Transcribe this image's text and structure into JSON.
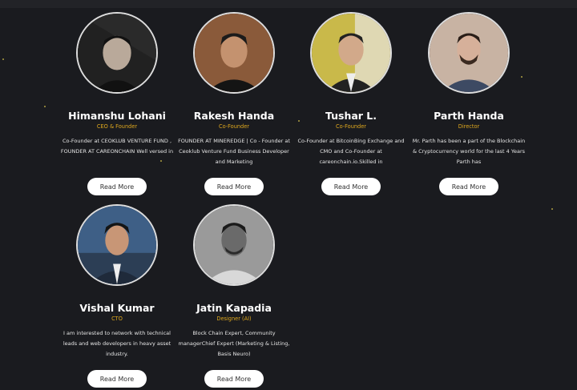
{
  "team": [
    {
      "name": "Himanshu Lohani",
      "role": "CEO & Founder",
      "bio": "Co-Founder at CEOKLUB VENTURE FUND , FOUNDER AT CAREONCHAIN Well versed in",
      "button": "Read More",
      "photo_bg": "#2a2a2a"
    },
    {
      "name": "Rakesh Handa",
      "role": "Co-Founder",
      "bio": "FOUNDER AT MINEREDGE | Co - Founder at Ceoklub Venture Fund Business Developer and Marketing",
      "button": "Read More",
      "photo_bg": "#8a5a3a"
    },
    {
      "name": "Tushar L.",
      "role": "Co-Founder",
      "bio": "Co-Founder at BitcoinBing Exchange and CMO and Co-Founder at careonchain.io.Skilled in",
      "button": "Read More",
      "photo_bg": "#c9b94a"
    },
    {
      "name": "Parth Handa",
      "role": "Director",
      "bio": "Mr. Parth has been a part of the Blockchain & Cryptocurrency world for the last 4 Years Parth has",
      "button": "Read More",
      "photo_bg": "#c8b3a3"
    },
    {
      "name": "Vishal Kumar",
      "role": "CTO",
      "bio": "I am interested to network with technical leads and web developers in heavy asset industry.",
      "button": "Read More",
      "photo_bg": "#3e5f86"
    },
    {
      "name": "Jatin Kapadia",
      "role": "Designer (AI)",
      "bio": "Block Chain Expert, Community managerChief Expert (Marketing & Listing, Basis Neuro)",
      "button": "Read More",
      "photo_bg": "#9a9a9a"
    }
  ]
}
